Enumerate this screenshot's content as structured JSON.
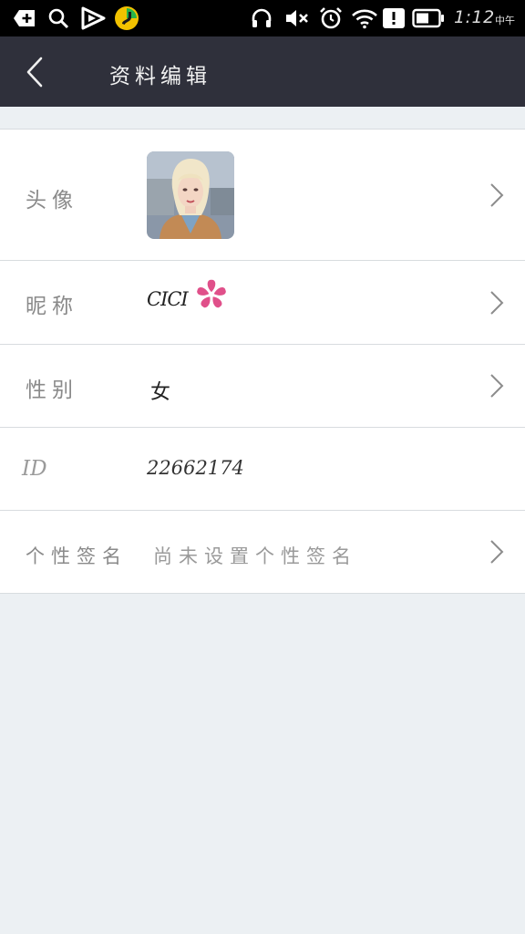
{
  "status_bar": {
    "left_icons": [
      "add-icon",
      "search-icon",
      "play-icon",
      "music-app-icon"
    ],
    "right_icons": [
      "headphones-icon",
      "mute-icon",
      "alarm-icon",
      "wifi-icon",
      "alert-icon",
      "battery-icon"
    ],
    "time": "1:12",
    "period": "中午"
  },
  "header": {
    "back_icon": "back-arrow-icon",
    "title": "资料编辑",
    "background": "#2f303b"
  },
  "profile": {
    "avatar": {
      "label": "头像"
    },
    "nickname": {
      "label": "昵称",
      "value": "CICI",
      "decoration": "sakura-flower-icon"
    },
    "gender": {
      "label": "性别",
      "value": "女"
    },
    "id": {
      "label": "ID",
      "value": "22662174"
    },
    "signature": {
      "label": "个性签名",
      "value": "尚未设置个性签名"
    }
  },
  "colors": {
    "page_bg": "#ecf0f3",
    "row_bg": "#ffffff",
    "divider": "#d8dcdf",
    "label_text": "#8a8a8a",
    "flower": "#e0508a"
  }
}
